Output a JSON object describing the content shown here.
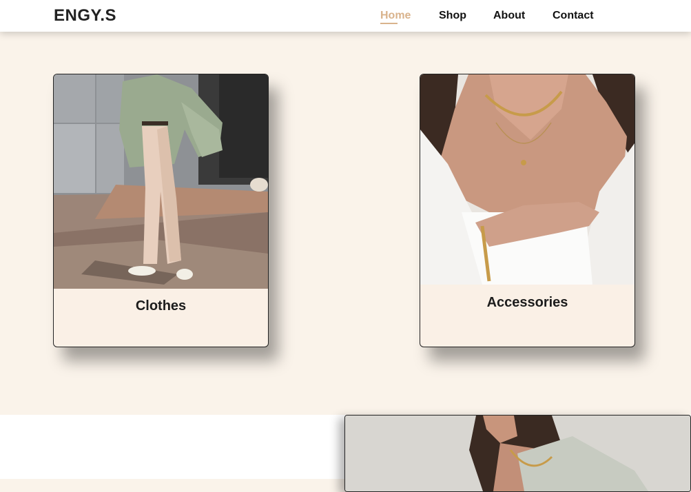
{
  "brand": "ENGY.S",
  "nav": {
    "home": "Home",
    "shop": "Shop",
    "about": "About",
    "contact": "Contact"
  },
  "categories": {
    "clothes": "Clothes",
    "accessories": "Accessories"
  },
  "colors": {
    "accent": "#d9b38c",
    "background": "#faf3ea"
  }
}
